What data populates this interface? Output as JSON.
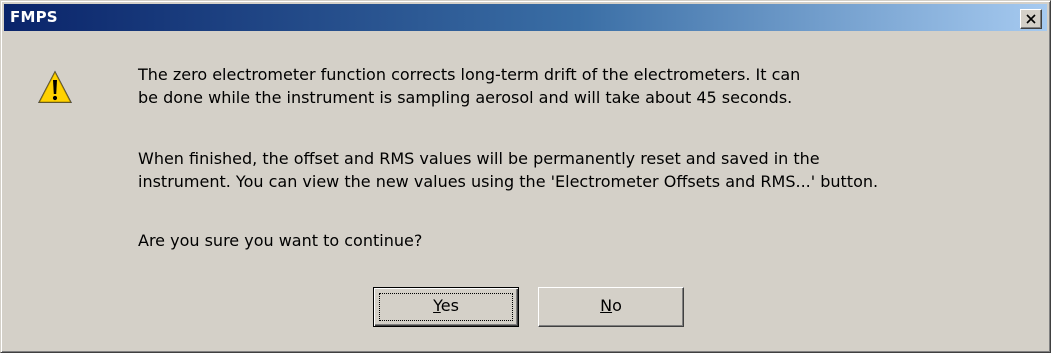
{
  "window": {
    "title": "FMPS"
  },
  "icon": "warning-icon",
  "message": {
    "paragraph1_line1": "The zero electrometer function corrects long-term drift of the electrometers. It can",
    "paragraph1_line2": "be done while the instrument is sampling aerosol and will take about 45 seconds.",
    "paragraph2_line1": "When finished, the offset and RMS values will be permanently reset and saved in the",
    "paragraph2_line2": "instrument. You can view the new values using the 'Electrometer Offsets and RMS...' button.",
    "question": "Are you sure you want to continue?"
  },
  "buttons": {
    "yes_mnemonic": "Y",
    "yes_rest": "es",
    "no_mnemonic": "N",
    "no_rest": "o"
  },
  "colors": {
    "title_start": "#0a246a",
    "title_end": "#a6caf0",
    "face": "#d4d0c8",
    "warning_fill": "#ffd200"
  }
}
